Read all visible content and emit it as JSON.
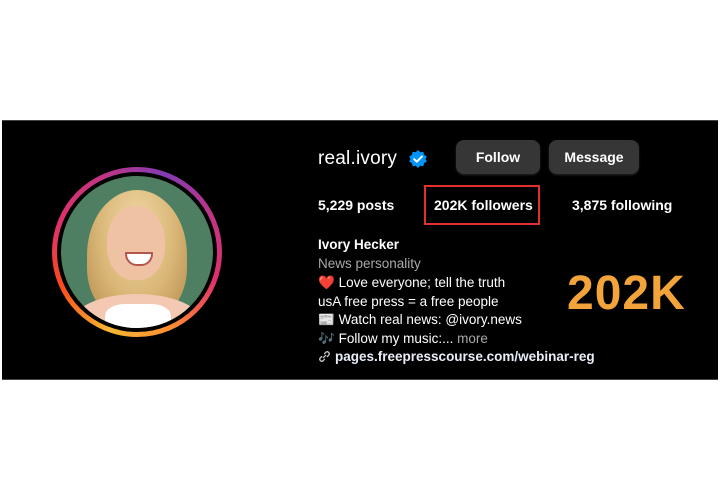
{
  "profile": {
    "username": "real.ivory",
    "verified_icon": "verified-badge-icon",
    "buttons": {
      "follow": "Follow",
      "message": "Message"
    },
    "stats": {
      "posts": "5,229 posts",
      "followers": "202K followers",
      "following": "3,875 following"
    },
    "bio": {
      "name": "Ivory Hecker",
      "category": "News personality",
      "line1_emoji": "❤️",
      "line1": "Love everyone; tell the truth",
      "line2": "usA free press = a free people",
      "line3_emoji": "📰",
      "line3": "Watch real news: @ivory.news",
      "line4_emoji": "🎶",
      "line4": "Follow my music:...",
      "more": "more",
      "link_icon": "link-icon",
      "link": "pages.freepresscourse.com/webinar-reg"
    }
  },
  "overlay": {
    "highlight_count": "202K"
  },
  "colors": {
    "panel_bg": "#000000",
    "button_bg": "#363636",
    "verified_blue": "#0095f6",
    "highlight_box": "#e0312f",
    "overlay_text": "#f2a43a"
  }
}
